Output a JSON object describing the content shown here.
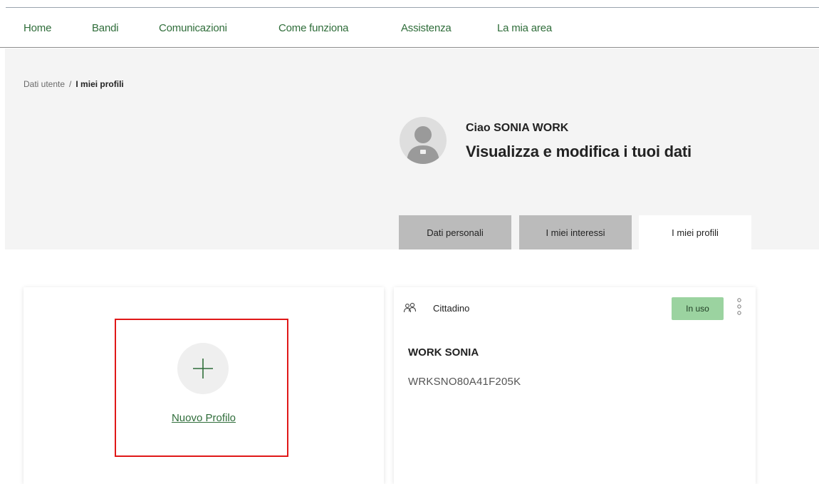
{
  "nav": {
    "items": [
      {
        "label": "Home"
      },
      {
        "label": "Bandi"
      },
      {
        "label": "Comunicazioni"
      },
      {
        "label": "Come funziona"
      },
      {
        "label": "Assistenza"
      },
      {
        "label": "La mia area"
      }
    ]
  },
  "breadcrumb": {
    "parent": "Dati utente",
    "separator": "/",
    "current": "I miei profili"
  },
  "user": {
    "greeting": "Ciao SONIA WORK",
    "subtitle": "Visualizza e modifica i tuoi dati"
  },
  "tabs": [
    {
      "label": "Dati personali",
      "active": false
    },
    {
      "label": "I miei interessi",
      "active": false
    },
    {
      "label": "I miei profili",
      "active": true
    }
  ],
  "new_profile": {
    "label": "Nuovo Profilo",
    "icon": "plus-icon"
  },
  "profile_card": {
    "role": "Cittadino",
    "role_icon": "people-icon",
    "status": "In uso",
    "name": "WORK SONIA",
    "code": "WRKSNO80A41F205K"
  },
  "colors": {
    "accent": "#2f6d3a",
    "badge": "#9bd3a0",
    "highlight": "#e01818",
    "hero_bg": "#f4f4f4",
    "tab_inactive": "#bbbbbb"
  }
}
